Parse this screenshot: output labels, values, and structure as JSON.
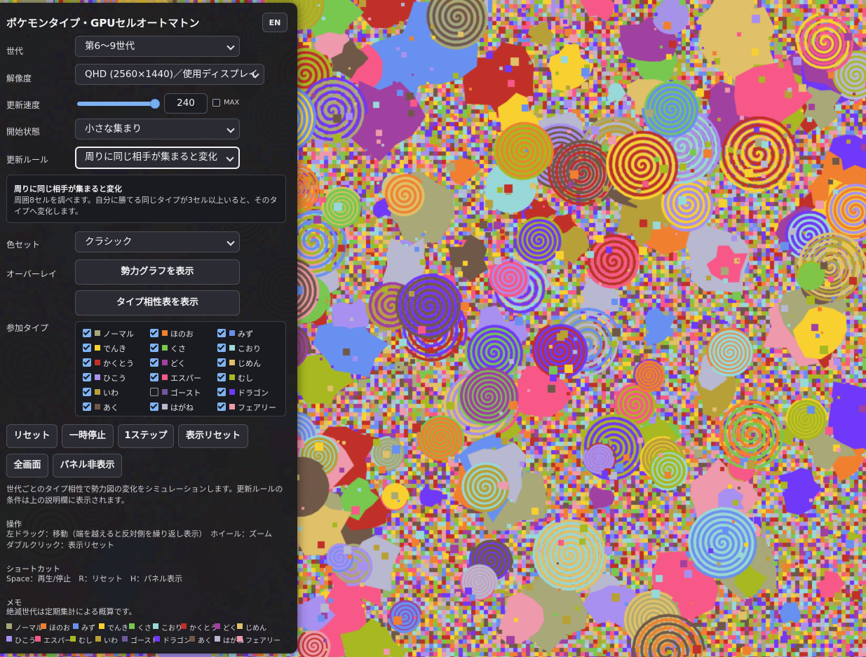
{
  "app": {
    "title": "ポケモンタイプ・GPUセルオートマトン",
    "lang_button": "EN"
  },
  "controls": {
    "generation": {
      "label": "世代",
      "value": "第6〜9世代"
    },
    "resolution": {
      "label": "解像度",
      "value": "QHD (2560×1440)／使用ディスプレイ"
    },
    "speed": {
      "label": "更新速度",
      "value": "240",
      "slider_level": 1.0,
      "max_label": "MAX",
      "max_checked": false
    },
    "initial_state": {
      "label": "開始状態",
      "value": "小さな集まり"
    },
    "rule": {
      "label": "更新ルール",
      "value": "周りに同じ相手が集まると変化"
    },
    "rule_description": {
      "title": "周りに同じ相手が集まると変化",
      "text": "周囲8セルを調べます。自分に勝てる同じタイプが3セル以上いると、そのタイプへ変化します。"
    },
    "palette": {
      "label": "色セット",
      "value": "クラシック"
    },
    "overlay": {
      "label": "オーバーレイ",
      "power_graph_button": "勢力グラフを表示",
      "type_chart_button": "タイプ相性表を表示"
    },
    "types_label": "参加タイプ"
  },
  "types": [
    {
      "name": "ノーマル",
      "color": "#a8a878",
      "checked": true
    },
    {
      "name": "ほのお",
      "color": "#f08030",
      "checked": true
    },
    {
      "name": "みず",
      "color": "#6890f0",
      "checked": true
    },
    {
      "name": "でんき",
      "color": "#f8d030",
      "checked": true
    },
    {
      "name": "くさ",
      "color": "#78c850",
      "checked": true
    },
    {
      "name": "こおり",
      "color": "#98d8d8",
      "checked": true
    },
    {
      "name": "かくとう",
      "color": "#c03028",
      "checked": true
    },
    {
      "name": "どく",
      "color": "#a040a0",
      "checked": true
    },
    {
      "name": "じめん",
      "color": "#e0c068",
      "checked": true
    },
    {
      "name": "ひこう",
      "color": "#a890f0",
      "checked": true
    },
    {
      "name": "エスパー",
      "color": "#f85888",
      "checked": true
    },
    {
      "name": "むし",
      "color": "#a8b820",
      "checked": true
    },
    {
      "name": "いわ",
      "color": "#b8a038",
      "checked": true
    },
    {
      "name": "ゴースト",
      "color": "#705898",
      "checked": false
    },
    {
      "name": "ドラゴン",
      "color": "#7038f8",
      "checked": true
    },
    {
      "name": "あく",
      "color": "#705848",
      "checked": true
    },
    {
      "name": "はがね",
      "color": "#b8b8d0",
      "checked": true
    },
    {
      "name": "フェアリー",
      "color": "#ee99ac",
      "checked": true
    }
  ],
  "actions": {
    "reset": "リセット",
    "pause": "一時停止",
    "step": "1ステップ",
    "view_reset": "表示リセット",
    "fullscreen": "全画面",
    "hide_panel": "パネル非表示"
  },
  "notes": {
    "intro": "世代ごとのタイプ相性で勢力図の変化をシミュレーションします。更新ルールの条件は上の説明欄に表示されます。",
    "controls_heading": "操作",
    "controls_text": "左ドラッグ：移動（端を越えると反対側を繰り返し表示）　ホイール：ズーム　ダブルクリック：表示リセット",
    "shortcuts_heading": "ショートカット",
    "shortcuts_text": "Space：再生/停止　R：リセット　H：パネル表示",
    "memo_heading": "メモ",
    "memo_text": "絶滅世代は定期集計による概算です。"
  }
}
